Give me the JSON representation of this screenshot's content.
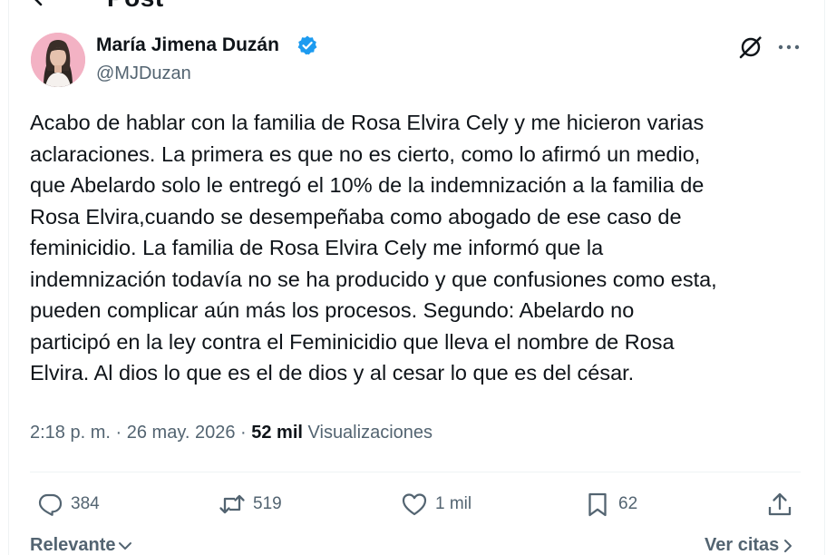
{
  "header": {
    "title": "Post"
  },
  "author": {
    "name": "María Jimena Duzán",
    "handle": "@MJDuzan",
    "verified": true,
    "avatar": "woman-portrait-avatar"
  },
  "tweet": {
    "text": "Acabo de hablar con la familia de Rosa Elvira Cely y me hicieron varias\naclaraciones. La primera es que no es cierto, como lo afirmó un medio,\nque Abelardo solo le entregó el 10% de la indemnización a la familia de\nRosa Elvira,cuando se desempeñaba como abogado de ese caso de\nfeminicidio.  La familia de Rosa Elvira Cely me informó  que la\nindemnización todavía no se ha producido y que confusiones como esta,\npueden complicar aún más los procesos.     Segundo: Abelardo no\nparticipó en la ley contra el Feminicidio que lleva el nombre de Rosa\nElvira. Al dios lo que es el de dios y al cesar lo que es del césar."
  },
  "meta": {
    "time": "2:18 p. m.",
    "separator": "·",
    "date": "26 may. 2026",
    "views_count": "52 mil",
    "views_label": "Visualizaciones"
  },
  "actions": {
    "replies": "384",
    "reposts": "519",
    "likes": "1 mil",
    "bookmarks": "62"
  },
  "footer": {
    "sort_label": "Relevante",
    "quotes_label": "Ver citas"
  },
  "colors": {
    "text": "#0f1419",
    "secondary": "#536471",
    "verified": "#1d9bf0",
    "divider": "#eff3f4"
  }
}
